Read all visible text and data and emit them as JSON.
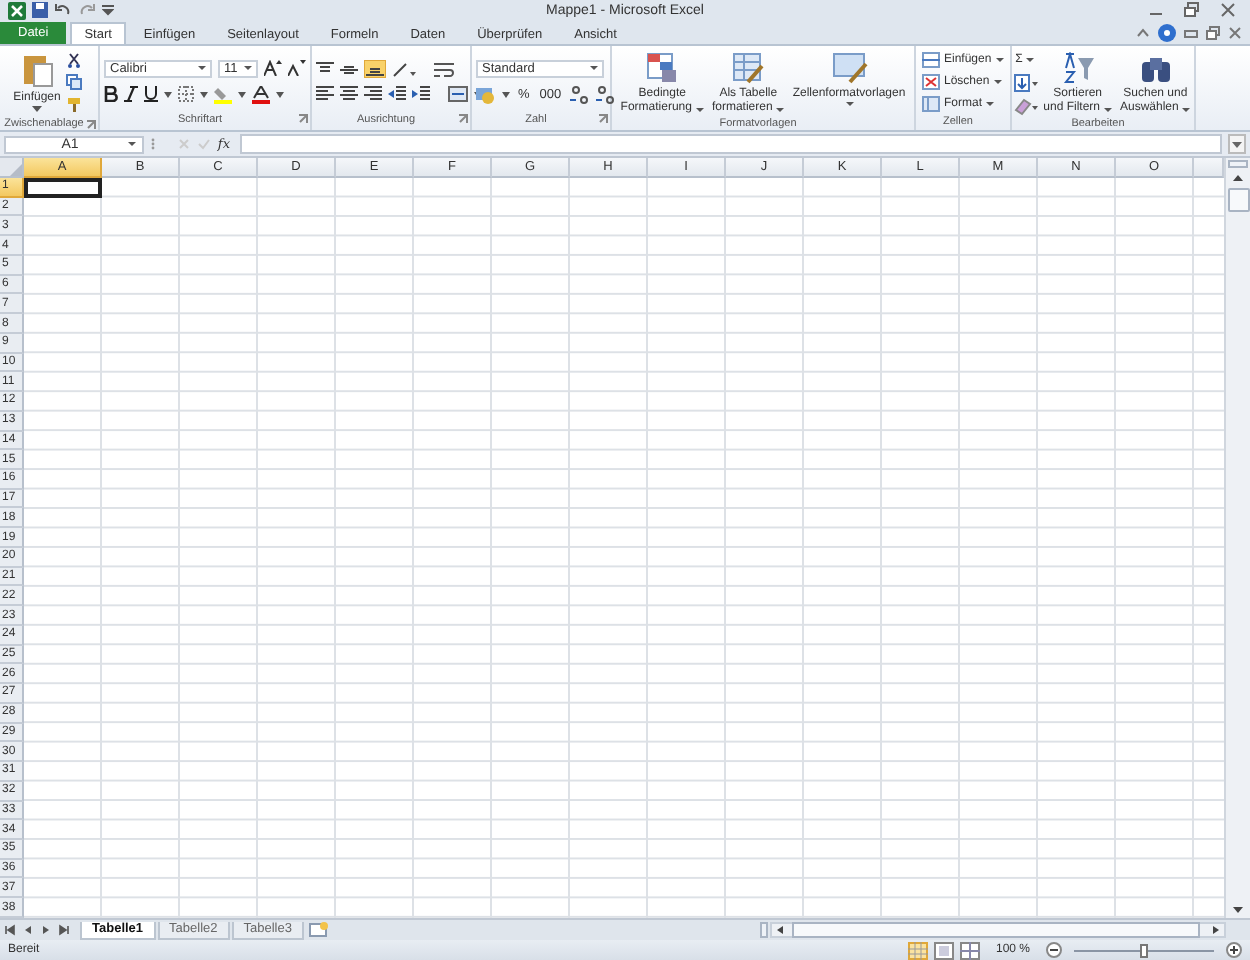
{
  "window": {
    "title": "Mappe1 - Microsoft Excel"
  },
  "tabs": [
    {
      "label": "Datei",
      "kind": "file",
      "selected": false
    },
    {
      "label": "Start",
      "kind": "tab",
      "selected": true
    },
    {
      "label": "Einfügen",
      "kind": "tab",
      "selected": false
    },
    {
      "label": "Seitenlayout",
      "kind": "tab",
      "selected": false
    },
    {
      "label": "Formeln",
      "kind": "tab",
      "selected": false
    },
    {
      "label": "Daten",
      "kind": "tab",
      "selected": false
    },
    {
      "label": "Überprüfen",
      "kind": "tab",
      "selected": false
    },
    {
      "label": "Ansicht",
      "kind": "tab",
      "selected": false
    }
  ],
  "ribbon": {
    "clipboard": {
      "label": "Zwischenablage",
      "paste": "Einfügen"
    },
    "font": {
      "label": "Schriftart",
      "font_name": "Calibri",
      "font_size": "11"
    },
    "alignment": {
      "label": "Ausrichtung"
    },
    "number": {
      "label": "Zahl",
      "format": "Standard",
      "percent": "%",
      "thousands": "000"
    },
    "styles": {
      "label": "Formatvorlagen",
      "buttons": [
        {
          "lines": [
            "Bedingte",
            "Formatierung"
          ]
        },
        {
          "lines": [
            "Als Tabelle",
            "formatieren"
          ]
        },
        {
          "lines": [
            "Zellenformatvorlagen"
          ]
        }
      ]
    },
    "cells": {
      "label": "Zellen",
      "buttons": [
        "Einfügen",
        "Löschen",
        "Format"
      ]
    },
    "editing": {
      "label": "Bearbeiten",
      "sum": "Σ",
      "buttons": [
        {
          "lines": [
            "Sortieren",
            "und Filtern"
          ]
        },
        {
          "lines": [
            "Suchen und",
            "Auswählen"
          ]
        }
      ]
    }
  },
  "formula_bar": {
    "name_box": "A1",
    "function_label": "fx"
  },
  "sheet": {
    "columns": [
      {
        "label": "A",
        "selected": true
      },
      {
        "label": "B",
        "selected": false
      },
      {
        "label": "C",
        "selected": false
      },
      {
        "label": "D",
        "selected": false
      },
      {
        "label": "E",
        "selected": false
      },
      {
        "label": "F",
        "selected": false
      },
      {
        "label": "G",
        "selected": false
      },
      {
        "label": "H",
        "selected": false
      },
      {
        "label": "I",
        "selected": false
      },
      {
        "label": "J",
        "selected": false
      },
      {
        "label": "K",
        "selected": false
      },
      {
        "label": "L",
        "selected": false
      },
      {
        "label": "M",
        "selected": false
      },
      {
        "label": "N",
        "selected": false
      },
      {
        "label": "O",
        "selected": false
      }
    ],
    "rows": [
      {
        "label": "1",
        "selected": true
      },
      {
        "label": "2",
        "selected": false
      },
      {
        "label": "3",
        "selected": false
      },
      {
        "label": "4",
        "selected": false
      },
      {
        "label": "5",
        "selected": false
      },
      {
        "label": "6",
        "selected": false
      },
      {
        "label": "7",
        "selected": false
      },
      {
        "label": "8",
        "selected": false
      },
      {
        "label": "9",
        "selected": false
      },
      {
        "label": "10",
        "selected": false
      },
      {
        "label": "11",
        "selected": false
      },
      {
        "label": "12",
        "selected": false
      },
      {
        "label": "13",
        "selected": false
      },
      {
        "label": "14",
        "selected": false
      },
      {
        "label": "15",
        "selected": false
      },
      {
        "label": "16",
        "selected": false
      },
      {
        "label": "17",
        "selected": false
      },
      {
        "label": "18",
        "selected": false
      },
      {
        "label": "19",
        "selected": false
      },
      {
        "label": "20",
        "selected": false
      },
      {
        "label": "21",
        "selected": false
      },
      {
        "label": "22",
        "selected": false
      },
      {
        "label": "23",
        "selected": false
      },
      {
        "label": "24",
        "selected": false
      },
      {
        "label": "25",
        "selected": false
      },
      {
        "label": "26",
        "selected": false
      },
      {
        "label": "27",
        "selected": false
      },
      {
        "label": "28",
        "selected": false
      },
      {
        "label": "29",
        "selected": false
      },
      {
        "label": "30",
        "selected": false
      },
      {
        "label": "31",
        "selected": false
      },
      {
        "label": "32",
        "selected": false
      },
      {
        "label": "33",
        "selected": false
      },
      {
        "label": "34",
        "selected": false
      },
      {
        "label": "35",
        "selected": false
      },
      {
        "label": "36",
        "selected": false
      },
      {
        "label": "37",
        "selected": false
      },
      {
        "label": "38",
        "selected": false
      }
    ]
  },
  "sheet_tabs": [
    {
      "label": "Tabelle1",
      "selected": true
    },
    {
      "label": "Tabelle2",
      "selected": false
    },
    {
      "label": "Tabelle3",
      "selected": false
    }
  ],
  "status_bar": {
    "status": "Bereit",
    "zoom": "100 %",
    "zoom_slider": {
      "level": 0.5
    }
  }
}
